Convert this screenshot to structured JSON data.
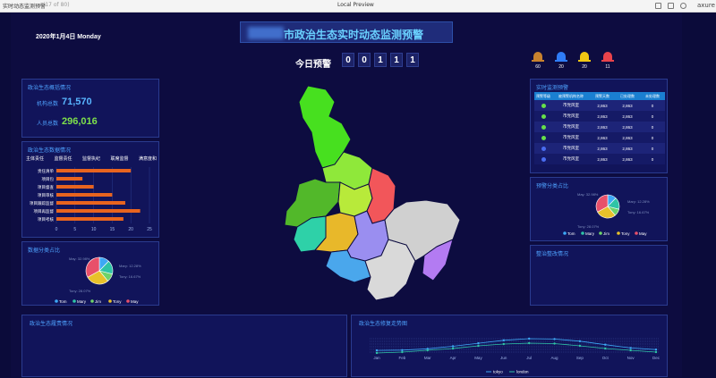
{
  "window": {
    "title": "实时动态监测预警",
    "page_indicator": "(17 of 80)",
    "center_title": "Local Preview",
    "brand": "axure"
  },
  "header": {
    "date": "2020年1月4日 Monday",
    "title_suffix": "市政治生态实时动态监测预警",
    "today_label": "今日预警",
    "digits": [
      "0",
      "0",
      "1",
      "1",
      "1"
    ]
  },
  "alerts": [
    {
      "icon": "siren-brown-icon",
      "color": "#c8822e",
      "count": "60"
    },
    {
      "icon": "siren-blue-icon",
      "color": "#2f7cf6",
      "count": "20"
    },
    {
      "icon": "siren-yellow-icon",
      "color": "#f2c813",
      "count": "20"
    },
    {
      "icon": "siren-red-icon",
      "color": "#e8434b",
      "count": "11"
    }
  ],
  "overview": {
    "title": "政治生态概括情况",
    "org_label": "机构总数",
    "org_value": "71,570",
    "people_label": "人员总数",
    "people_value": "296,016"
  },
  "data_panel": {
    "title": "政治生态数据情况",
    "tabs": [
      "主体责任",
      "监督责任",
      "监督执纪",
      "联席监督",
      "满意度和"
    ],
    "chart_data": {
      "type": "bar",
      "orientation": "horizontal",
      "categories": [
        "责任清单",
        "项目包",
        "项目督查",
        "项目审核",
        "项目跟踪监督",
        "项目再监督",
        "项目考核"
      ],
      "values": [
        20,
        7,
        10,
        15,
        18.5,
        22.5,
        18
      ],
      "xlim": [
        0,
        25
      ],
      "xticks": [
        "0",
        "5",
        "10",
        "15",
        "20",
        "25"
      ],
      "color": "#e8641f"
    }
  },
  "pie_left": {
    "title": "数据分类占比",
    "chart_data": {
      "type": "pie",
      "labels": [
        "Tom",
        "Mary",
        "Jim",
        "Tony",
        "May"
      ],
      "values": [
        12.28,
        16.67,
        10,
        28.07,
        32.98
      ],
      "colors": [
        "#3da8f5",
        "#2ec4a6",
        "#6fd36a",
        "#e8c12a",
        "#e8506a"
      ],
      "annotations": [
        "May: 32.98%",
        "Mary: 12.28%",
        "Tony: 16.67%",
        "Tony: 28.07%"
      ]
    },
    "legend": [
      "Tom",
      "Mary",
      "Jim",
      "Tony",
      "May"
    ]
  },
  "realtime": {
    "title": "实时监测预警",
    "headers": [
      "预警等级",
      "被预警机构名称",
      "预警天数",
      "已处理数",
      "未处理数"
    ],
    "rows": [
      {
        "level": "green",
        "name": "市党风室",
        "days": "2,863",
        "done": "2,863",
        "todo": "0"
      },
      {
        "level": "green",
        "name": "市党风室",
        "days": "2,863",
        "done": "2,863",
        "todo": "0"
      },
      {
        "level": "green",
        "name": "市党风室",
        "days": "2,863",
        "done": "2,863",
        "todo": "0"
      },
      {
        "level": "green",
        "name": "市党风室",
        "days": "2,863",
        "done": "2,863",
        "todo": "0"
      },
      {
        "level": "blue",
        "name": "市党风室",
        "days": "2,863",
        "done": "2,863",
        "todo": "0"
      },
      {
        "level": "blue",
        "name": "市党风室",
        "days": "2,863",
        "done": "2,863",
        "todo": "0"
      }
    ],
    "level_colors": {
      "green": "#66e04a",
      "blue": "#4a6cf0"
    }
  },
  "pie_right": {
    "title": "预警分类占比",
    "chart_data": {
      "type": "pie",
      "labels": [
        "Tom",
        "Mary",
        "Jim",
        "Tony",
        "May"
      ],
      "values": [
        12.28,
        16.67,
        10,
        28.07,
        32.98
      ],
      "colors": [
        "#3da8f5",
        "#2ec4a6",
        "#6fd36a",
        "#e8c12a",
        "#e8506a"
      ],
      "annotations": [
        "May: 32.98%",
        "Mary: 12.28%",
        "Tony: 16.67%",
        "Tony: 28.07%"
      ]
    },
    "legend": [
      "Tom",
      "Mary",
      "Jim",
      "Tony",
      "May"
    ]
  },
  "rectify": {
    "title": "整治整改情况"
  },
  "bottom_left": {
    "title": "政治生态履责情况"
  },
  "bottom_right": {
    "title": "政治生态修复走势图",
    "chart_data": {
      "type": "line",
      "x": [
        "Jan",
        "Feb",
        "Mar",
        "Apr",
        "May",
        "Jun",
        "Jul",
        "Aug",
        "Sep",
        "Oct",
        "Nov",
        "Dec"
      ],
      "series": [
        {
          "name": "tokyo",
          "color": "#3da8f5",
          "values": [
            3.9,
            4.2,
            5.7,
            8.5,
            11.9,
            15.2,
            17,
            16.6,
            14.2,
            10.3,
            6.6,
            4.8
          ]
        },
        {
          "name": "london",
          "color": "#2ec4a6",
          "values": [
            1,
            2,
            4,
            6,
            9,
            11,
            12,
            11.5,
            9,
            6,
            4,
            2
          ]
        }
      ]
    },
    "legend": [
      "tokyo",
      "london"
    ]
  }
}
